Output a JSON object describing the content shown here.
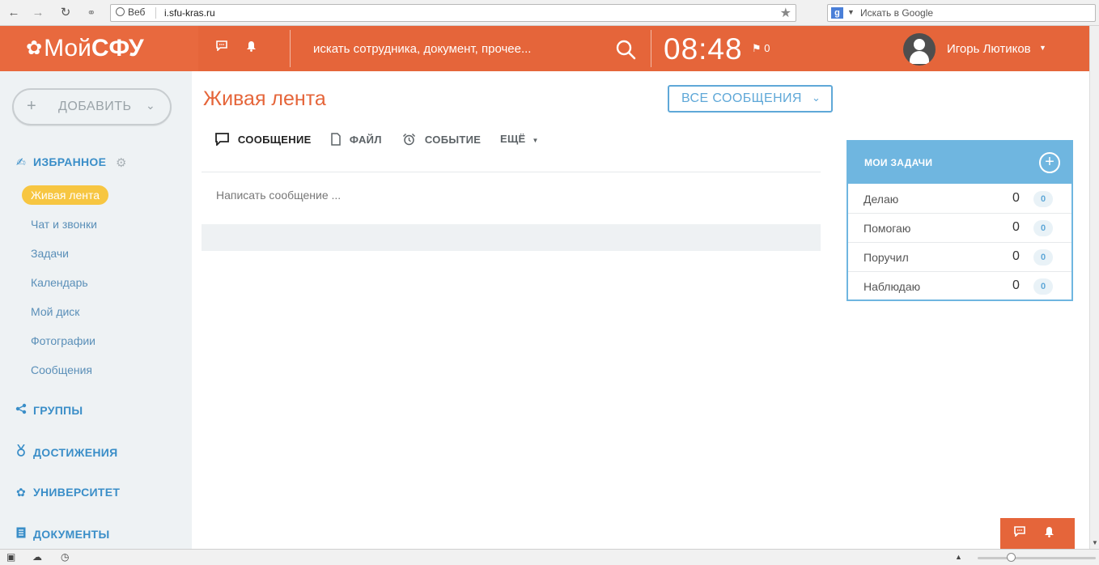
{
  "browser": {
    "web_label": "Веб",
    "url": "i.sfu-kras.ru",
    "google_placeholder": "Искать в Google"
  },
  "header": {
    "logo_light": "Мой",
    "logo_bold": "СФУ",
    "search_placeholder": "искать сотрудника, документ, прочее...",
    "clock": "08:48",
    "flag_count": "0",
    "user_name": "Игорь Лютиков"
  },
  "sidebar": {
    "add_label": "ДОБАВИТЬ",
    "favorites_title": "ИЗБРАННОЕ",
    "items": [
      {
        "label": "Живая лента"
      },
      {
        "label": "Чат и звонки"
      },
      {
        "label": "Задачи"
      },
      {
        "label": "Календарь"
      },
      {
        "label": "Мой диск"
      },
      {
        "label": "Фотографии"
      },
      {
        "label": "Сообщения"
      }
    ],
    "sections": [
      {
        "label": "ГРУППЫ"
      },
      {
        "label": "ДОСТИЖЕНИЯ"
      },
      {
        "label": "УНИВЕРСИТЕТ"
      },
      {
        "label": "ДОКУМЕНТЫ"
      }
    ]
  },
  "main": {
    "title": "Живая лента",
    "filter_label": "ВСЕ СООБЩЕНИЯ",
    "tabs": [
      {
        "label": "СООБЩЕНИЕ"
      },
      {
        "label": "ФАЙЛ"
      },
      {
        "label": "СОБЫТИЕ"
      },
      {
        "label": "ЕЩЁ"
      }
    ],
    "compose_placeholder": "Написать сообщение ..."
  },
  "tasks": {
    "title": "МОИ ЗАДАЧИ",
    "rows": [
      {
        "label": "Делаю",
        "count": "0",
        "badge": "0"
      },
      {
        "label": "Помогаю",
        "count": "0",
        "badge": "0"
      },
      {
        "label": "Поручил",
        "count": "0",
        "badge": "0"
      },
      {
        "label": "Наблюдаю",
        "count": "0",
        "badge": "0"
      }
    ]
  },
  "colors": {
    "brand": "#e5653a",
    "accent_blue": "#5fa8d8",
    "active_pill": "#f7c641",
    "sidebar_bg": "#eef2f4"
  }
}
